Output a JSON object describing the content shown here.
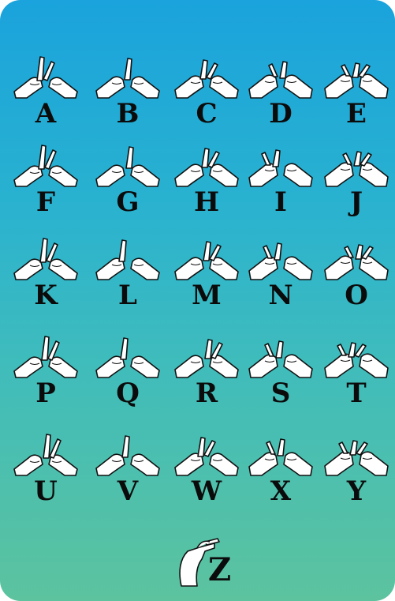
{
  "letters": [
    "A",
    "B",
    "C",
    "D",
    "E",
    "F",
    "G",
    "H",
    "I",
    "J",
    "K",
    "L",
    "M",
    "N",
    "O",
    "P",
    "Q",
    "R",
    "S",
    "T",
    "U",
    "V",
    "W",
    "X",
    "Y",
    "Z"
  ],
  "hand_icons": [
    "two-hands-a-icon",
    "two-hands-b-icon",
    "two-hands-c-icon",
    "two-hands-d-icon",
    "two-hands-e-icon",
    "two-hands-f-icon",
    "two-hands-g-icon",
    "two-hands-h-icon",
    "two-hands-i-icon",
    "two-hands-j-icon",
    "two-hands-k-icon",
    "two-hands-l-icon",
    "two-hands-m-icon",
    "two-hands-n-icon",
    "two-hands-o-icon",
    "two-hands-p-icon",
    "two-hands-q-icon",
    "two-hands-r-icon",
    "two-hands-s-icon",
    "two-hands-t-icon",
    "two-hands-u-icon",
    "two-hands-v-icon",
    "two-hands-w-icon",
    "two-hands-x-icon",
    "two-hands-y-icon",
    "arm-z-icon"
  ],
  "colors": {
    "gradient_top": "#1aa3dc",
    "gradient_bottom": "#5cc39e",
    "letter": "#0b0b0b",
    "hand_fill": "#ffffff",
    "hand_stroke": "#111111"
  }
}
